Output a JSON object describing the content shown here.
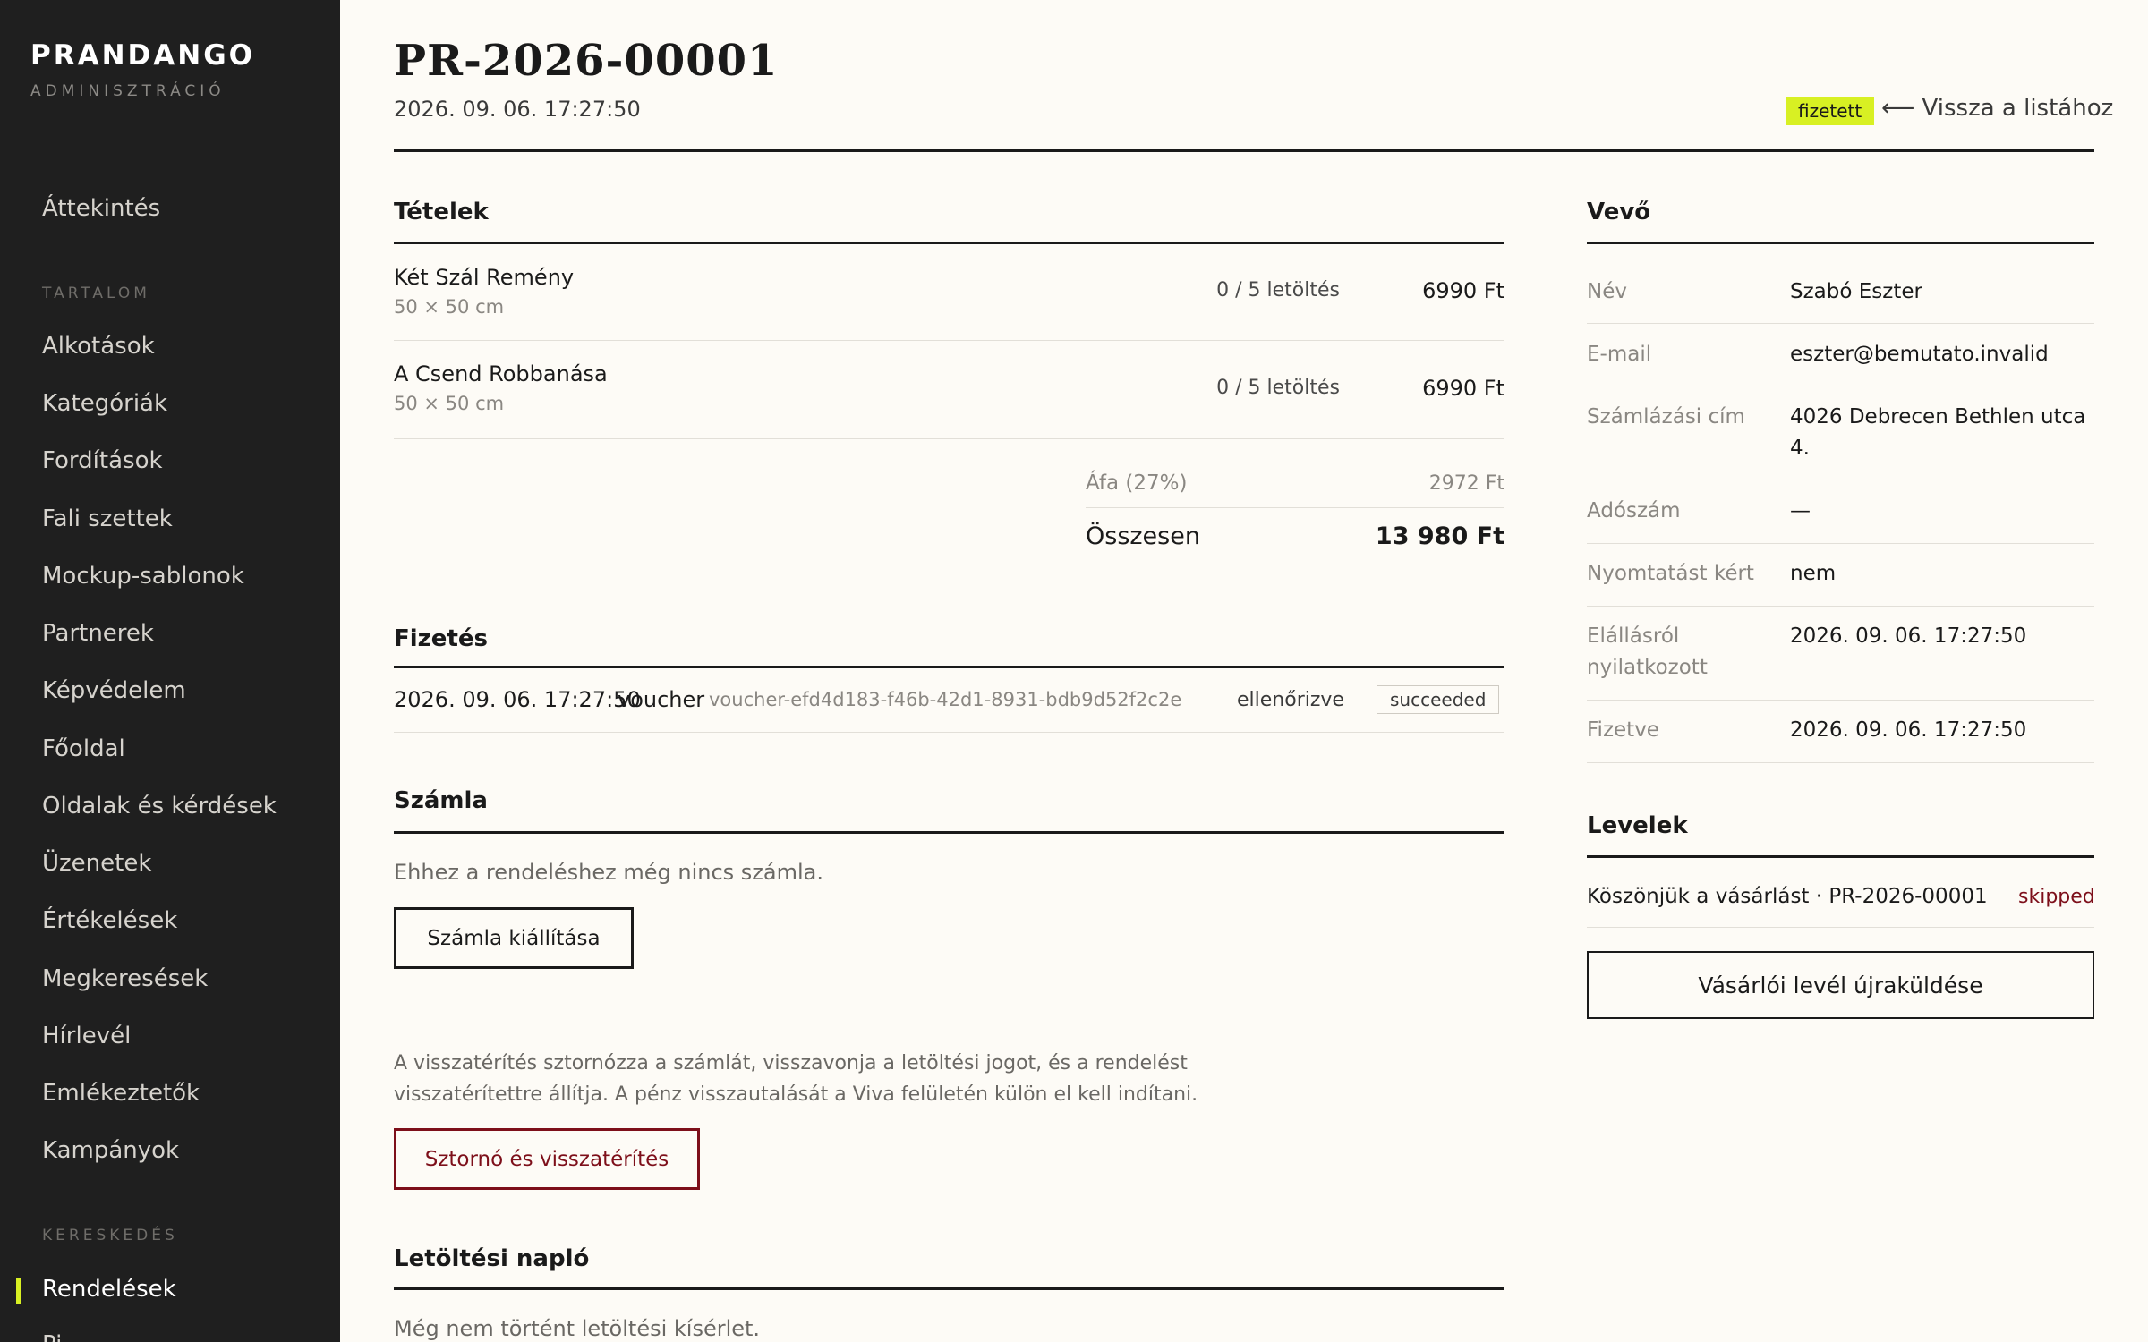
{
  "brand": {
    "name": "PRANDANGO",
    "subtitle": "ADMINISZTRÁCIÓ"
  },
  "sidebar": {
    "overview": "Áttekintés",
    "section_content": "TARTALOM",
    "content_items": [
      "Alkotások",
      "Kategóriák",
      "Fordítások",
      "Fali szettek",
      "Mockup-sablonok",
      "Partnerek",
      "Képvédelem",
      "Főoldal",
      "Oldalak és kérdések",
      "Üzenetek",
      "Értékelések",
      "Megkeresések",
      "Hírlevél",
      "Emlékeztetők",
      "Kampányok"
    ],
    "section_commerce": "KERESKEDÉS",
    "active_item": "Rendelések",
    "accent_color": "#d8f023"
  },
  "header": {
    "order_id": "PR-2026-00001",
    "datetime": "2026. 09. 06. 17:27:50",
    "status": "fizetett",
    "back_link": "⟵ Vissza a listához"
  },
  "items": {
    "title": "Tételek",
    "rows": [
      {
        "name": "Két Szál Remény",
        "size": "50 × 50 cm",
        "downloads": "0 / 5 letöltés",
        "price": "6990 Ft"
      },
      {
        "name": "A Csend Robbanása",
        "size": "50 × 50 cm",
        "downloads": "0 / 5 letöltés",
        "price": "6990 Ft"
      }
    ],
    "vat_label": "Áfa (27%)",
    "vat_value": "2972 Ft",
    "total_label": "Összesen",
    "total_value": "13 980 Ft"
  },
  "payment": {
    "title": "Fizetés",
    "datetime": "2026. 09. 06. 17:27:50",
    "method": "voucher",
    "reference": "voucher-efd4d183-f46b-42d1-8931-bdb9d52f2c2e",
    "verification": "ellenőrizve",
    "status": "succeeded"
  },
  "invoice": {
    "title": "Számla",
    "empty_text": "Ehhez a rendeléshez még nincs számla.",
    "issue_button": "Számla kiállítása",
    "refund_note_line1": "A visszatérítés sztornózza a számlát, visszavonja a letöltési jogot, és a rendelést",
    "refund_note_line2": "visszatérítettre állítja. A pénz visszautalását a Viva felületén külön el kell indítani.",
    "refund_button": "Sztornó és visszatérítés"
  },
  "download_log": {
    "title": "Letöltési napló",
    "empty_text": "Még nem történt letöltési kísérlet."
  },
  "customer": {
    "title": "Vevő",
    "fields": [
      {
        "label": "Név",
        "value": "Szabó Eszter"
      },
      {
        "label": "E-mail",
        "value": "eszter@bemutato.invalid"
      },
      {
        "label": "Számlázási cím",
        "value": "4026 Debrecen Bethlen utca 4."
      },
      {
        "label": "Adószám",
        "value": "—"
      },
      {
        "label": "Nyomtatást kért",
        "value": "nem"
      },
      {
        "label": "Elállásról nyilatkozott",
        "value": "2026. 09. 06. 17:27:50"
      },
      {
        "label": "Fizetve",
        "value": "2026. 09. 06. 17:27:50"
      }
    ]
  },
  "emails": {
    "title": "Levelek",
    "rows": [
      {
        "subject": "Köszönjük a vásárlást · PR-2026-00001",
        "status": "skipped"
      }
    ],
    "resend_button": "Vásárlói levél újraküldése"
  }
}
